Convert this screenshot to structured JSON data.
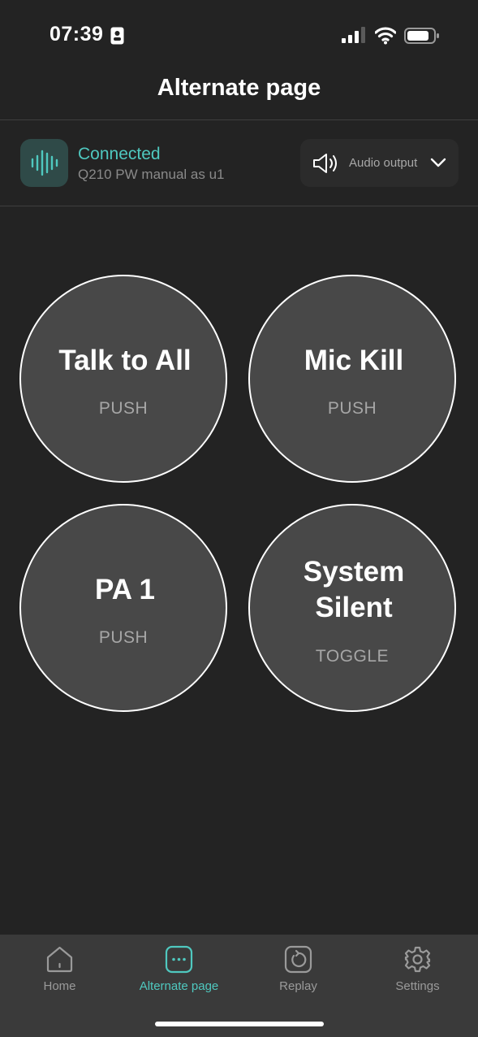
{
  "status_bar": {
    "time": "07:39"
  },
  "header": {
    "title": "Alternate page"
  },
  "connection": {
    "status": "Connected",
    "device": "Q210 PW manual as u1",
    "audio_output_label": "Audio output"
  },
  "buttons": [
    {
      "name": "Talk to All",
      "mode": "PUSH"
    },
    {
      "name": "Mic Kill",
      "mode": "PUSH"
    },
    {
      "name": "PA 1",
      "mode": "PUSH"
    },
    {
      "name_line1": "System",
      "name_line2": "Silent",
      "mode": "TOGGLE"
    }
  ],
  "tabs": [
    {
      "label": "Home",
      "icon": "home-icon"
    },
    {
      "label": "Alternate page",
      "icon": "ellipsis-icon",
      "active": true
    },
    {
      "label": "Replay",
      "icon": "replay-icon"
    },
    {
      "label": "Settings",
      "icon": "gear-icon"
    }
  ],
  "colors": {
    "accent": "#4fc8bf",
    "background": "#232323",
    "pad": "#484848",
    "tabbar": "#3a3a3a"
  }
}
